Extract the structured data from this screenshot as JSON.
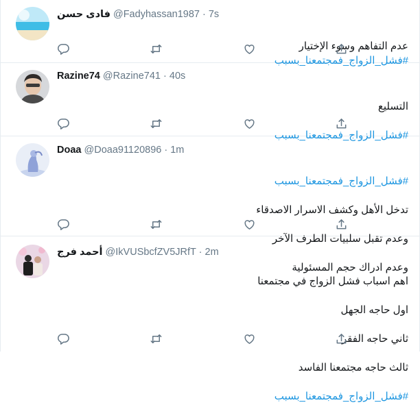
{
  "tweets": [
    {
      "name": "فادى حسن",
      "handle": "@Fadyhassan1987",
      "dot": "·",
      "time": "7s",
      "lines": [
        "عدم التفاهم وسوء الإختيار"
      ],
      "hashtag": "#فشل_الزواج_فمجتمعنا_بسبب",
      "hashtag_inline": true,
      "avatar_colors": [
        "#b9e6f7",
        "#4fc3e8",
        "#f2e3c2"
      ]
    },
    {
      "name": "Razine74",
      "handle": "@Razine741",
      "dot": "·",
      "time": "40s",
      "lines": [
        "التسليع"
      ],
      "hashtag": "#فشل_الزواج_فمجتمعنا_بسبب",
      "hashtag_inline": false,
      "avatar_colors": [
        "#d7d9dc",
        "#3c3a38",
        "#e7c9b2"
      ]
    },
    {
      "name": "Doaa",
      "handle": "@Doaa91120896",
      "dot": "·",
      "time": "1m",
      "hashtag_first": "#فشل_الزواج_فمجتمعنا_بسبب",
      "lines": [
        "تدخل الأهل وكشف الاسرار الاصدقاء",
        "وعدم تقبل سلبيات الطرف الآخر",
        "وعدم ادراك حجم المسئولية"
      ],
      "avatar_colors": [
        "#e8edf6",
        "#aebfe6",
        "#7d8fc9"
      ]
    },
    {
      "name": "أحمد فرج",
      "handle": "@IkVUSbcfZV5JRfT",
      "dot": "·",
      "time": "2m",
      "lines": [
        "اهم اسباب فشل الزواج في مجتمعنا",
        " اول حاجه الجهل",
        " ثاني حاجه الفقر",
        " ثالث حاجه مجتمعنا الفاسد"
      ],
      "hashtag": "#فشل_الزواج_فمجتمعنا_بسبب",
      "avatar_colors": [
        "#e9d6e4",
        "#2b2b2b",
        "#c0a090"
      ]
    }
  ],
  "icons": {
    "reply": "reply-icon",
    "retweet": "retweet-icon",
    "like": "like-icon",
    "share": "share-icon"
  },
  "colors": {
    "hashtag": "#1b95e0",
    "secondary_text": "#657786",
    "divider": "#e6ecf0"
  }
}
